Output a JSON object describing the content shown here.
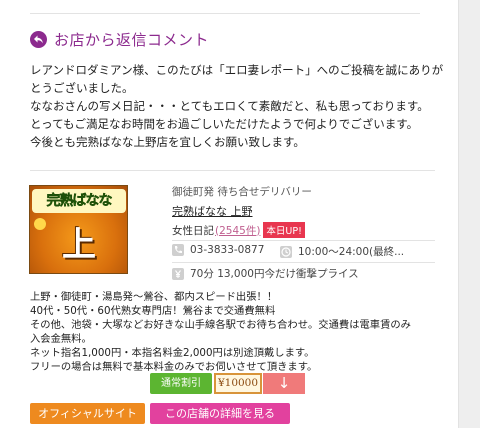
{
  "reply": {
    "title": "お店から返信コメント",
    "lines": [
      "レアンドロダミアン様、このたびは「エロ妻レポート」へのご投稿を誠にありが",
      "とうございました。",
      "ななおさんの写メ日記・・・とてもエロくて素敵だと、私も思っております。",
      "とってもご満足なお時間をお過ごしいただけたようで何よりでございます。",
      "今後とも完熟ばなな上野店を宜しくお願い致します。"
    ]
  },
  "shop": {
    "logo_top": "完熟ばなな",
    "logo_main": "上野",
    "area": "御徒町発 待ち合せデリバリー",
    "name": "完熟ばなな 上野",
    "diary_label": "女性日記",
    "diary_count": "(2545件)",
    "update_badge": "本日UP!",
    "phone": "03-3833-0877",
    "hours": "10:00～24:00(最終...",
    "price": "70分 13,000円今だけ衝撃プライス",
    "description": [
      "上野・御徒町・湯島発～鶯谷、都内スピード出張！！",
      "40代・50代・60代熟女専門店！鶯谷まで交通費無料",
      "その他、池袋・大塚などお好きな山手線各駅でお待ち合わせ。交通費は電車賃のみ",
      "入会金無料。",
      "ネット指名1,000円・本指名料金2,000円は別途頂戴します。",
      "フリーの場合は無料で基本料金のみでお伺いさせて頂きます。"
    ]
  },
  "buttons": {
    "regular_discount": "通常割引",
    "coupon": "¥10000",
    "down_arrow": "↓",
    "official_site": "オフィシャルサイト",
    "shop_detail": "この店舗の詳細を見る"
  },
  "icons": {
    "reply": "reply-arrow-icon",
    "phone": "phone-icon",
    "clock": "clock-icon",
    "yen": "yen-icon"
  },
  "colors": {
    "accent_purple": "#8c2a8e",
    "green": "#5cb531",
    "orange": "#ee8a1f",
    "pink": "#e2419e",
    "red_badge": "#e8364f"
  }
}
